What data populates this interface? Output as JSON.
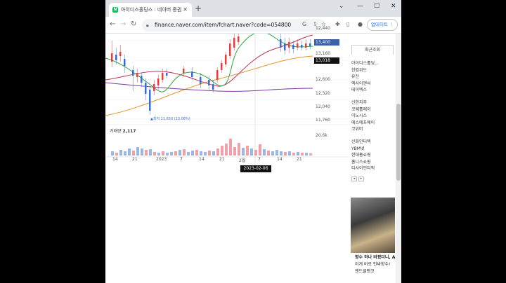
{
  "browser": {
    "tab_title": "아이디스홀딩스 : 네이버 증권",
    "url": "finance.naver.com/item/fchart.naver?code=054800",
    "update_label": "업데이트"
  },
  "chart": {
    "price_labels": [
      "12,440",
      "13,400",
      "13,160",
      "13,018",
      "12,600",
      "12,320",
      "12,040",
      "11,760"
    ],
    "current_price": "13,400",
    "ma_price": "13,018",
    "low_annotation": "▲최저 11,650 (13.08%)",
    "volume_label": "거래량",
    "volume_value": "2,117",
    "volume_scale": "20.6k",
    "x_ticks": [
      "14",
      "21",
      "2023",
      "7",
      "14",
      "21",
      "2월",
      "7",
      "14",
      "21"
    ],
    "crosshair_date": "2023-02-06",
    "colors": {
      "up": "#e83f3f",
      "down": "#3b6dd8",
      "ma5": "#2ea63a",
      "ma20": "#c0304e",
      "ma60": "#e0962b",
      "ma120": "#7a3aa8"
    }
  },
  "sidebar": {
    "recent_title": "최근조회",
    "group1": [
      "아이디스홀딩...",
      "한컴위드",
      "유신",
      "엑사이엔씨",
      "테이텍스"
    ],
    "group2": [
      "신한지주",
      "코웨홀레이",
      "이노시스",
      "에스에프에이",
      "코위버"
    ],
    "group3": [
      "신화인터텍",
      "YBM넷",
      "현대홈쇼핑",
      "홈니스쇼핑",
      "티사이언티픽"
    ],
    "pager": [
      "◂",
      "▸"
    ],
    "ad_line1": "향수 하나 바꿨더니, A",
    "ad_line2": "이게 바로 인싸향수!",
    "ad_line3": "엔드클랜코"
  }
}
